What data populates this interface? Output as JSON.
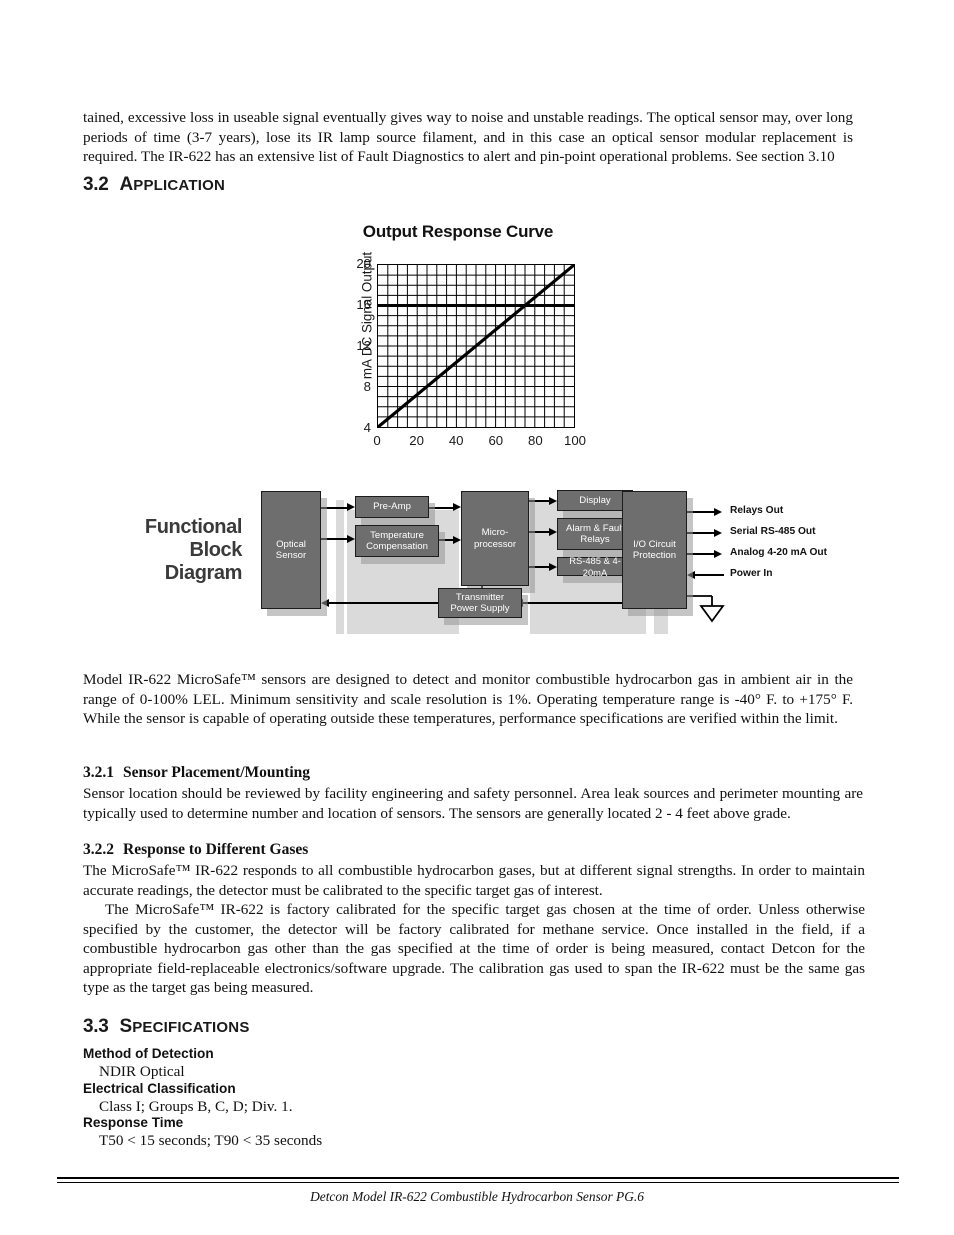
{
  "body": {
    "intro_paragraph": "tained, excessive loss in useable signal eventually gives way to noise and unstable readings. The optical sensor may, over long periods of time (3-7 years), lose its IR lamp source filament, and in this case an optical sensor modular replacement is required. The IR-622 has an extensive list of Fault Diagnostics to alert and pin-point operational problems. See section 3.10",
    "application_paragraph": "Model IR-622 MicroSafe™ sensors are designed to detect and monitor combustible hydrocarbon gas in ambient air in the range of 0-100% LEL. Minimum sensitivity and scale resolution is 1%. Operating temperature range is -40° F. to +175° F. While the sensor is capable of operating outside these temperatures, performance specifications are verified within the limit.",
    "placement_paragraph": "Sensor location should be reviewed by facility engineering and safety personnel. Area leak sources and perimeter mounting are typically used to determine number and location of sensors. The sensors are generally located 2 - 4 feet above grade.",
    "gases_paragraph_1": "The MicroSafe™ IR-622 responds to all combustible hydrocarbon gases, but at different signal strengths. In order to maintain accurate readings, the detector must be calibrated to the specific target gas of interest.",
    "gases_paragraph_2": "The MicroSafe™ IR-622 is factory calibrated for the specific target gas chosen at the time of order. Unless otherwise specified by the customer, the detector will be factory calibrated for methane service. Once installed in the field, if a combustible hydrocarbon gas other than the gas specified at the time of order is being measured, contact Detcon for the appropriate field-replaceable electronics/software upgrade. The calibration gas used to span the IR-622 must be the same gas type as the target gas being measured."
  },
  "headings": {
    "application": {
      "number": "3.2",
      "first_letter": "A",
      "rest": "PPLICATION"
    },
    "specifications": {
      "number": "3.3",
      "first_letter": "S",
      "rest": "PECIFICATIONS"
    },
    "sensor_placement": {
      "number": "3.2.1",
      "text": "Sensor Placement/Mounting"
    },
    "response_gases": {
      "number": "3.2.2",
      "text": "Response to Different Gases"
    }
  },
  "specifications": {
    "items": [
      {
        "term": "Method of Detection",
        "value": "NDIR Optical"
      },
      {
        "term": "Electrical Classification",
        "value": "Class I; Groups B, C, D; Div. 1."
      },
      {
        "term": "Response Time",
        "value": "T50 < 15 seconds; T90 < 35 seconds"
      }
    ]
  },
  "footer": {
    "text": "Detcon Model IR-622 Combustible Hydrocarbon Sensor   PG.6"
  },
  "chart_data": {
    "type": "line",
    "title": "Output Response Curve",
    "xlabel": "",
    "ylabel": "mA DC Signal Output",
    "xlim": [
      0,
      100
    ],
    "ylim": [
      4,
      20
    ],
    "xticks": [
      "0",
      "20",
      "40",
      "60",
      "80",
      "100"
    ],
    "xtick_values": [
      0,
      20,
      40,
      60,
      80,
      100
    ],
    "yticks": [
      "20",
      "16",
      "12",
      "8",
      "4"
    ],
    "ytick_values": [
      20,
      16,
      12,
      8,
      4
    ],
    "grid": true,
    "grid_x_divisions": 20,
    "grid_y_divisions": 16,
    "legend": "none",
    "series": [
      {
        "name": "Output Response",
        "x": [
          0,
          100
        ],
        "values": [
          4,
          20
        ],
        "style": "solid-thick"
      }
    ],
    "annotations": [
      {
        "type": "hline",
        "y": 16,
        "style": "bold"
      }
    ]
  },
  "block_diagram": {
    "title_lines": [
      "Functional",
      "Block",
      "Diagram"
    ],
    "blocks": {
      "optical_sensor": "Optical\nSensor",
      "optical_sensor_l1": "Optical",
      "optical_sensor_l2": "Sensor",
      "pre_amp": "Pre-Amp",
      "temperature_compensation_l1": "Temperature",
      "temperature_compensation_l2": "Compensation",
      "microprocessor_l1": "Micro-",
      "microprocessor_l2": "processor",
      "display": "Display",
      "alarm_fault_relays_l1": "Alarm & Fault",
      "alarm_fault_relays_l2": "Relays",
      "rs485_4_20ma": "RS-485 & 4-20mA",
      "transmitter_power_supply_l1": "Transmitter",
      "transmitter_power_supply_l2": "Power Supply",
      "io_circuit_protection_l1": "I/O Circuit",
      "io_circuit_protection_l2": "Protection"
    },
    "io_labels": [
      "Relays Out",
      "Serial RS-485 Out",
      "Analog 4-20 mA Out",
      "Power In"
    ]
  },
  "colors": {
    "block_fill": "#6e6e6e",
    "block_border": "#1c1c1c",
    "block_text": "#ffffff",
    "diagram_title": "#3a3a3a",
    "text": "#111111"
  }
}
